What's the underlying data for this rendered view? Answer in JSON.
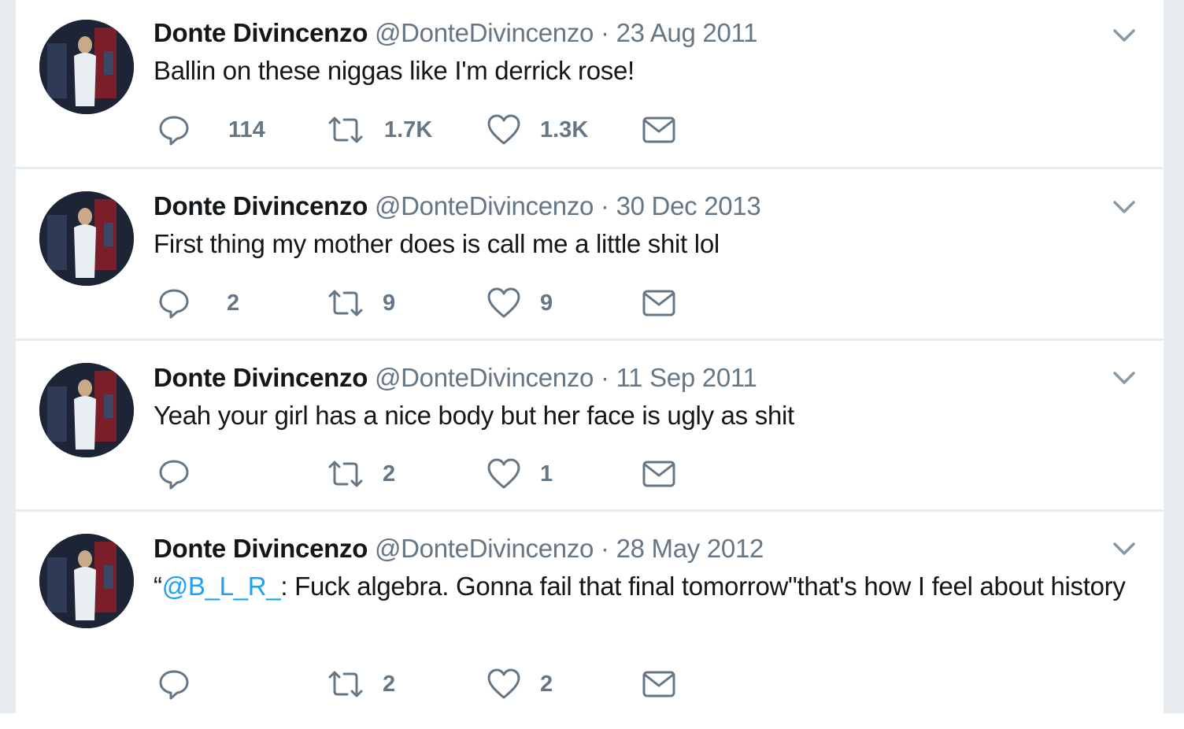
{
  "tweets": [
    {
      "name": "Donte Divincenzo",
      "handle": "@DonteDivincenzo",
      "separator": "·",
      "date": "23 Aug 2011",
      "text_prefix": "",
      "mention": "",
      "text": "Ballin on these niggas like I'm derrick rose!",
      "replies": "114",
      "retweets": "1.7K",
      "likes": "1.3K"
    },
    {
      "name": "Donte Divincenzo",
      "handle": "@DonteDivincenzo",
      "separator": "·",
      "date": "30 Dec 2013",
      "text_prefix": "",
      "mention": "",
      "text": "First thing my mother does is call me a little shit lol",
      "replies": "2",
      "retweets": "9",
      "likes": "9"
    },
    {
      "name": "Donte Divincenzo",
      "handle": "@DonteDivincenzo",
      "separator": "·",
      "date": "11 Sep 2011",
      "text_prefix": "",
      "mention": "",
      "text": "Yeah your girl has a nice body but her face is ugly as shit",
      "replies": "",
      "retweets": "2",
      "likes": "1"
    },
    {
      "name": "Donte Divincenzo",
      "handle": "@DonteDivincenzo",
      "separator": "·",
      "date": "28 May 2012",
      "text_prefix": "“",
      "mention": "@B_L_R_",
      "text": ": Fuck algebra. Gonna fail that final tomorrow\"that's how I feel about history",
      "replies": "",
      "retweets": "2",
      "likes": "2"
    }
  ],
  "icons": {
    "reply": "reply-icon",
    "retweet": "retweet-icon",
    "like": "heart-icon",
    "dm": "envelope-icon",
    "menu": "chevron-down-icon"
  },
  "colors": {
    "text": "#14171a",
    "secondary": "#657786",
    "mention": "#1da1f2",
    "divider": "#e6ecf0"
  }
}
